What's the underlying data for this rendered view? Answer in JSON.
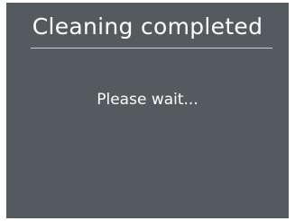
{
  "screen": {
    "title": "Cleaning completed",
    "message": "Please wait..."
  },
  "colors": {
    "background": "#555a5e",
    "text": "#ffffff",
    "divider": "#c8cbcd"
  }
}
